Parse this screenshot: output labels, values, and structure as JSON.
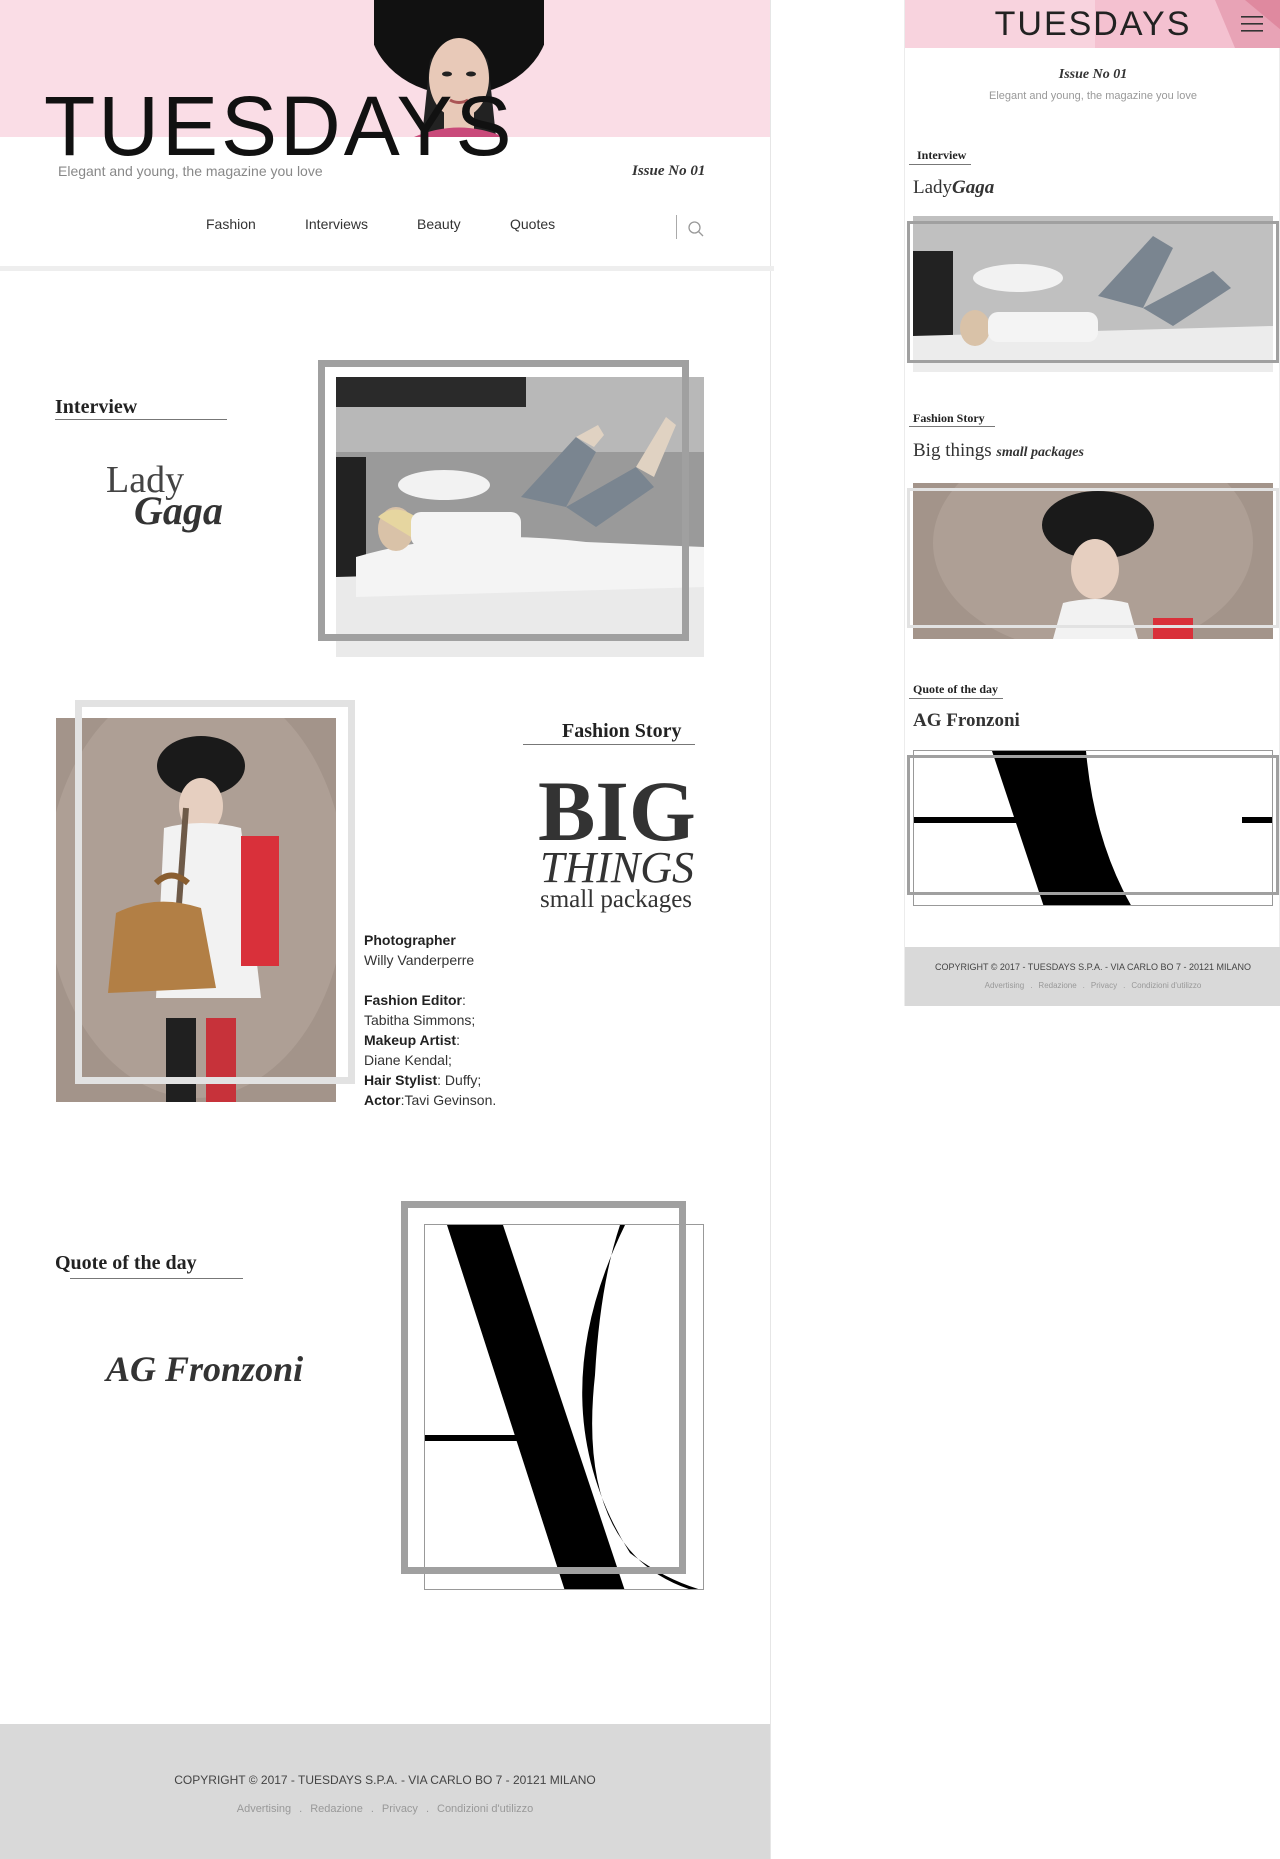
{
  "brand": {
    "logo": "TUESDAYS",
    "tagline": "Elegant and young, the magazine you love",
    "issue": "Issue No 01"
  },
  "nav": {
    "items": [
      "Fashion",
      "Interviews",
      "Beauty",
      "Quotes"
    ]
  },
  "interview": {
    "section": "Interview",
    "first": "Lady",
    "last": "Gaga"
  },
  "fashion": {
    "section": "Fashion Story",
    "big": "BIG",
    "things": "THINGS",
    "small": "small packages",
    "mobile_title_main": "Big things",
    "mobile_title_small": "small packages"
  },
  "credits": {
    "photographer_label": "Photographer",
    "photographer": "Willy Vanderperre",
    "editor_label": "Fashion Editor",
    "editor": "Tabitha Simmons;",
    "makeup_label": "Makeup Artist",
    "makeup": "Diane Kendal;",
    "hair_label": "Hair Stylist",
    "hair": "Duffy;",
    "actor_label": "Actor",
    "actor": "Tavi Gevinson."
  },
  "quote": {
    "section": "Quote of the day",
    "author": "AG Fronzoni"
  },
  "footer": {
    "copyright": "COPYRIGHT © 2017 - TUESDAYS S.P.A. - VIA CARLO BO 7 - 20121 MILANO",
    "links": [
      "Advertising",
      "Redazione",
      "Privacy",
      "Condizioni d'utilizzo"
    ],
    "separator": "."
  },
  "colors": {
    "pink": "#fadde6",
    "footer": "#d9d9d9",
    "frame": "#a0a0a0"
  },
  "icons": {
    "search": "search-icon",
    "menu": "hamburger-menu-icon"
  }
}
